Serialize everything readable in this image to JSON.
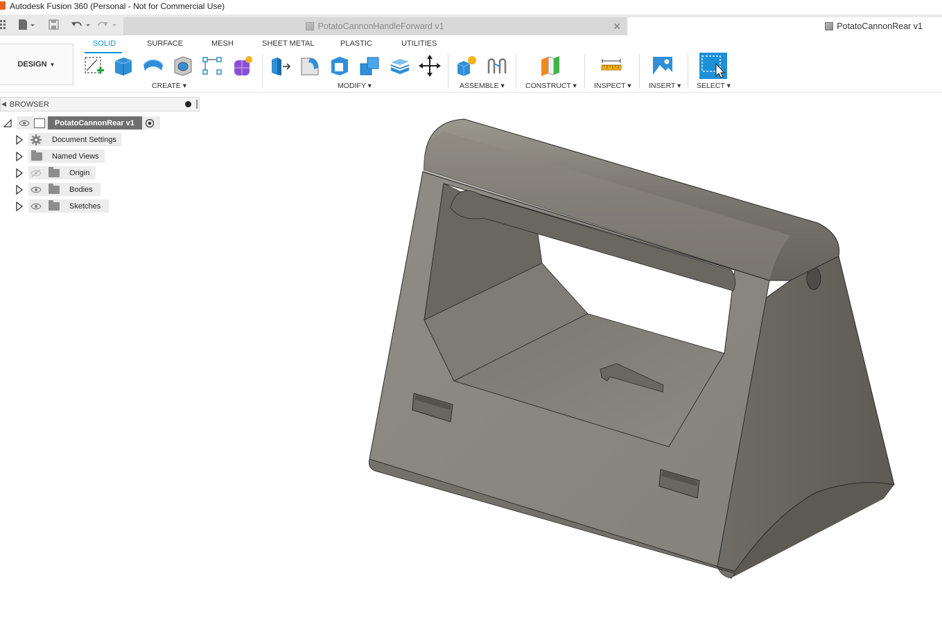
{
  "app": {
    "title": "Autodesk Fusion 360 (Personal - Not for Commercial Use)"
  },
  "document_tabs": [
    {
      "label": "PotatoCannonHandleForward v1",
      "active": false
    },
    {
      "label": "PotatoCannonRear v1",
      "active": true
    }
  ],
  "workspace": {
    "label": "DESIGN"
  },
  "ribbon_tabs": [
    "SOLID",
    "SURFACE",
    "MESH",
    "SHEET METAL",
    "PLASTIC",
    "UTILITIES"
  ],
  "groups": {
    "create": "CREATE",
    "modify": "MODIFY",
    "assemble": "ASSEMBLE",
    "construct": "CONSTRUCT",
    "inspect": "INSPECT",
    "insert": "INSERT",
    "select": "SELECT"
  },
  "browser": {
    "title": "BROWSER",
    "root": "PotatoCannonRear v1",
    "items": [
      {
        "label": "Document Settings",
        "icon": "gear-icon"
      },
      {
        "label": "Named Views",
        "icon": "folder-icon"
      },
      {
        "label": "Origin",
        "icon": "folder-icon"
      },
      {
        "label": "Bodies",
        "icon": "folder-icon"
      },
      {
        "label": "Sketches",
        "icon": "folder-icon"
      }
    ]
  },
  "colors": {
    "accent": "#0696d7",
    "model": "#8a8780",
    "model_dark": "#6e6b64",
    "model_light": "#a5a29b"
  }
}
